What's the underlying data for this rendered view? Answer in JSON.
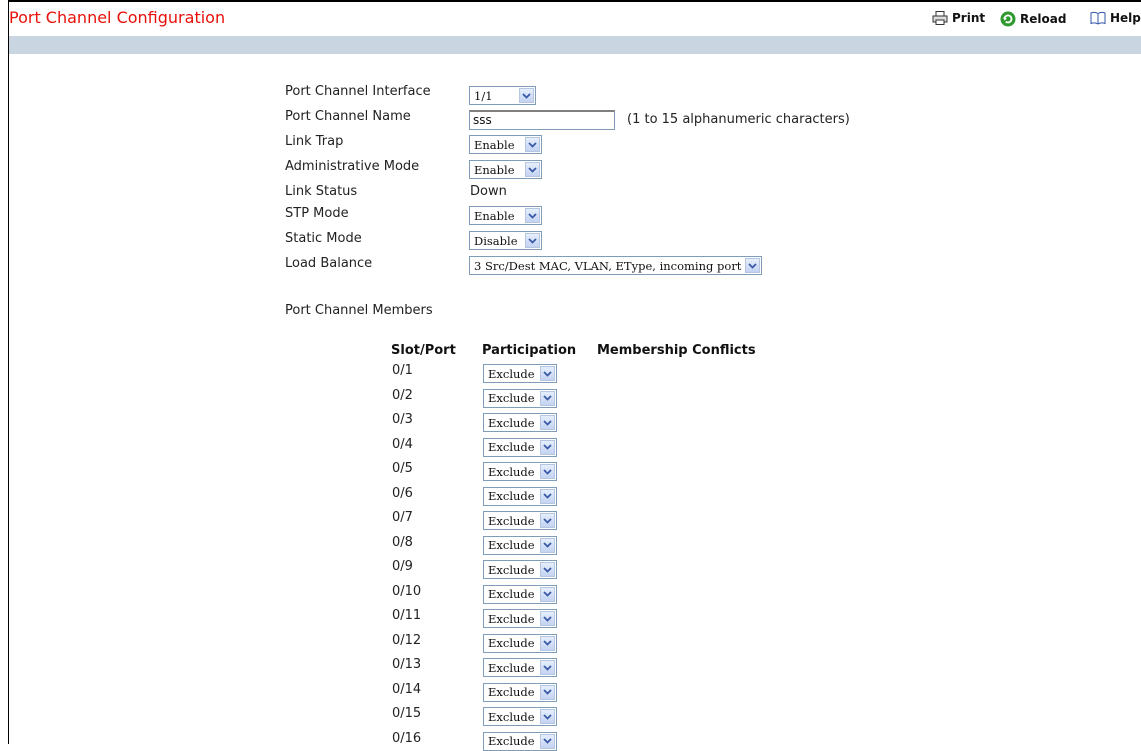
{
  "header": {
    "title": "Port Channel Configuration",
    "print_label": "Print",
    "reload_label": "Reload",
    "help_label": "Help"
  },
  "form": {
    "interface_label": "Port Channel Interface",
    "interface_value": "1/1",
    "name_label": "Port Channel Name",
    "name_value": "sss",
    "name_hint": "(1 to 15 alphanumeric characters)",
    "link_trap_label": "Link Trap",
    "link_trap_value": "Enable",
    "admin_mode_label": "Administrative Mode",
    "admin_mode_value": "Enable",
    "link_status_label": "Link Status",
    "link_status_value": "Down",
    "stp_mode_label": "STP Mode",
    "stp_mode_value": "Enable",
    "static_mode_label": "Static Mode",
    "static_mode_value": "Disable",
    "load_balance_label": "Load Balance",
    "load_balance_value": "3 Src/Dest MAC, VLAN, EType, incoming port"
  },
  "members": {
    "section_label": "Port Channel Members",
    "col_slot_port": "Slot/Port",
    "col_participation": "Participation",
    "col_conflicts": "Membership Conflicts",
    "rows": [
      {
        "port": "0/1",
        "participation": "Exclude"
      },
      {
        "port": "0/2",
        "participation": "Exclude"
      },
      {
        "port": "0/3",
        "participation": "Exclude"
      },
      {
        "port": "0/4",
        "participation": "Exclude"
      },
      {
        "port": "0/5",
        "participation": "Exclude"
      },
      {
        "port": "0/6",
        "participation": "Exclude"
      },
      {
        "port": "0/7",
        "participation": "Exclude"
      },
      {
        "port": "0/8",
        "participation": "Exclude"
      },
      {
        "port": "0/9",
        "participation": "Exclude"
      },
      {
        "port": "0/10",
        "participation": "Exclude"
      },
      {
        "port": "0/11",
        "participation": "Exclude"
      },
      {
        "port": "0/12",
        "participation": "Exclude"
      },
      {
        "port": "0/13",
        "participation": "Exclude"
      },
      {
        "port": "0/14",
        "participation": "Exclude"
      },
      {
        "port": "0/15",
        "participation": "Exclude"
      },
      {
        "port": "0/16",
        "participation": "Exclude"
      }
    ]
  },
  "colors": {
    "title": "#e8100a",
    "band": "#c9d6e2",
    "select_border": "#7f9db9"
  }
}
